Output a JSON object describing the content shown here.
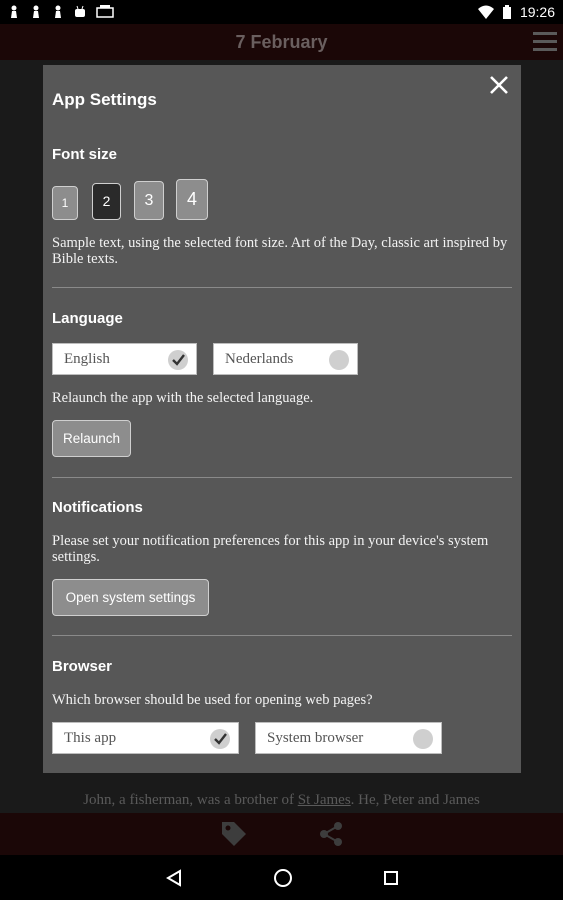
{
  "status_bar": {
    "time": "19:26"
  },
  "app_bar": {
    "title": "7 February"
  },
  "background": {
    "text_before": "John, a fisherman, was a brother of ",
    "link": "St James",
    "text_after": ". He, Peter and James"
  },
  "dialog": {
    "title": "App Settings",
    "font_size": {
      "heading": "Font size",
      "options": [
        "1",
        "2",
        "3",
        "4"
      ],
      "selected": "2",
      "sample": "Sample text, using the selected font size. Art of the Day, classic art inspired by Bible texts."
    },
    "language": {
      "heading": "Language",
      "options": [
        {
          "label": "English",
          "selected": true
        },
        {
          "label": "Nederlands",
          "selected": false
        }
      ],
      "note": "Relaunch the app with the selected language.",
      "button": "Relaunch"
    },
    "notifications": {
      "heading": "Notifications",
      "text": "Please set your notification preferences for this app in your device's system settings.",
      "button": "Open system settings"
    },
    "browser": {
      "heading": "Browser",
      "question": "Which browser should be used for opening web pages?",
      "options": [
        {
          "label": "This app",
          "selected": true
        },
        {
          "label": "System browser",
          "selected": false
        }
      ]
    }
  },
  "colors": {
    "dialog_bg": "#575757",
    "app_bar_bg": "#1b0707",
    "button_bg": "#8d8d8d"
  }
}
